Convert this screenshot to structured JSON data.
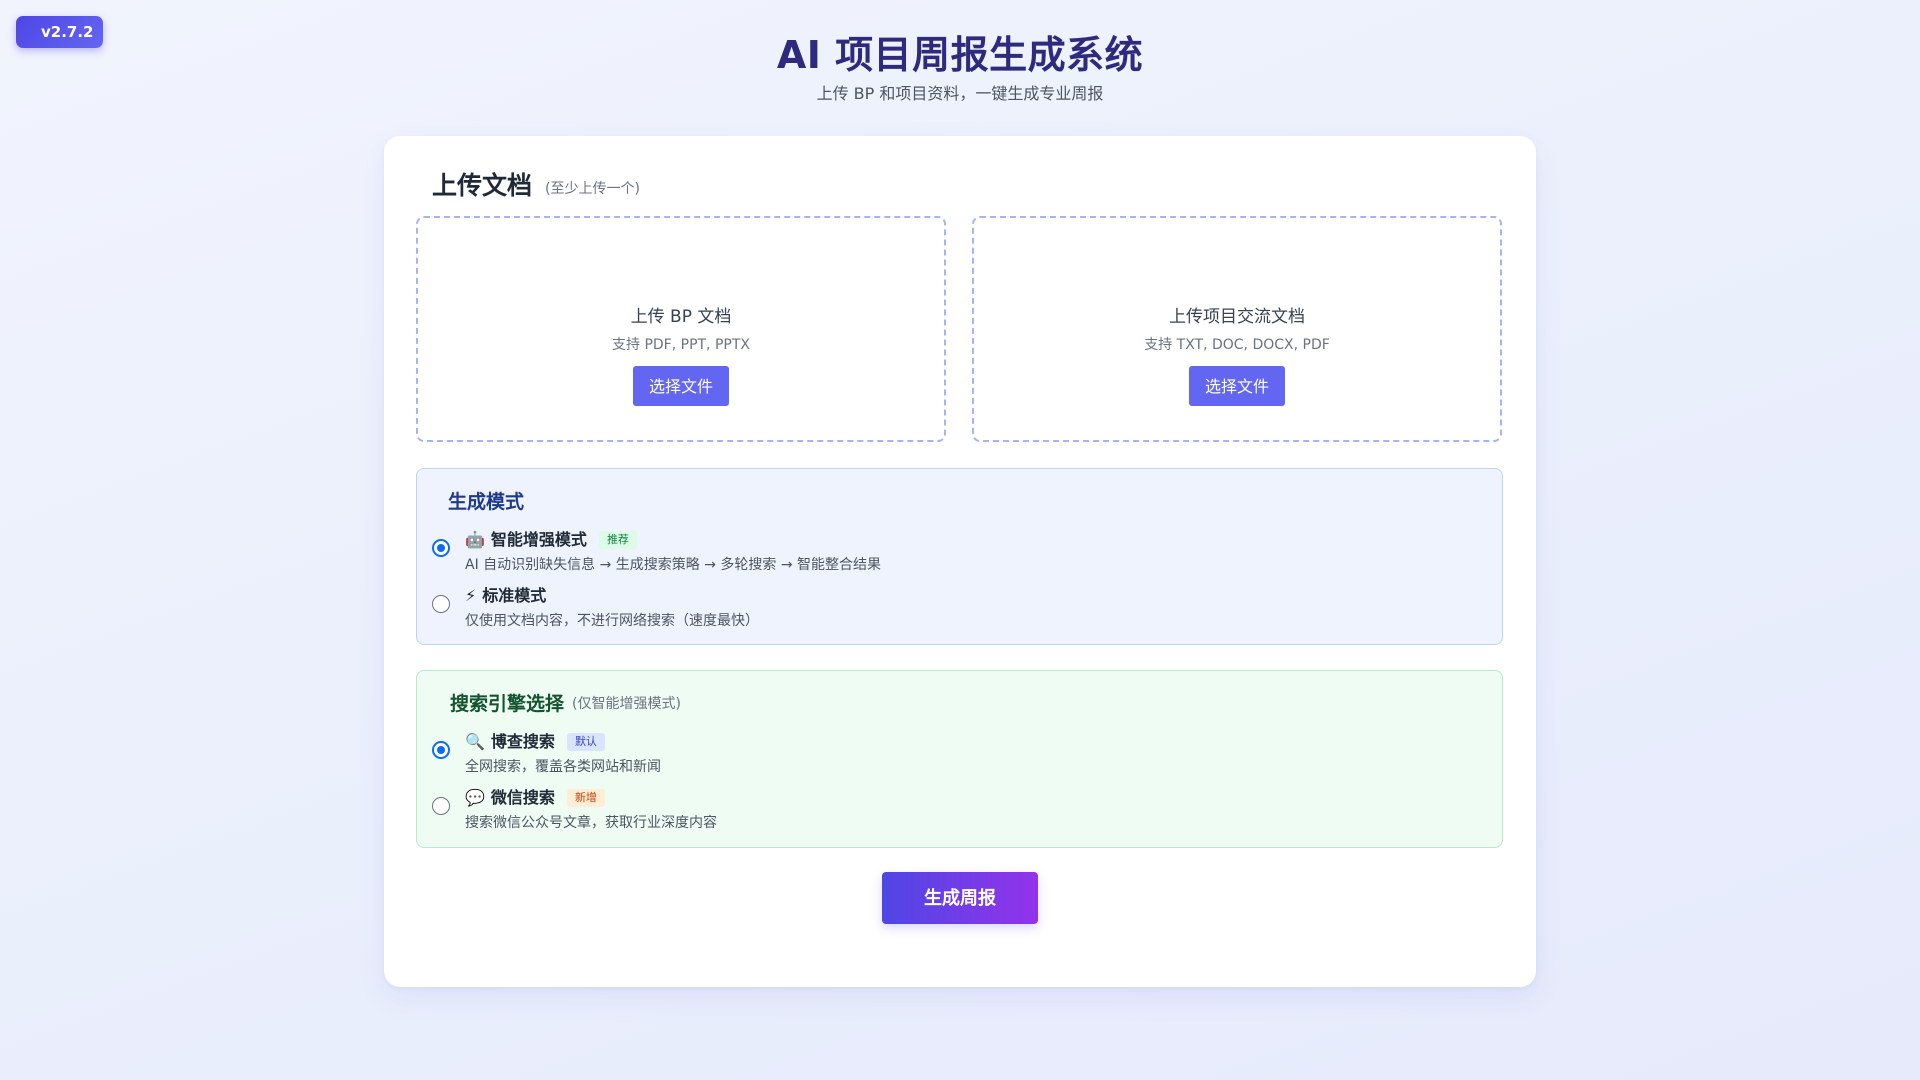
{
  "version": "v2.7.2",
  "header": {
    "title": "AI 项目周报生成系统",
    "subtitle": "上传 BP 和项目资料，一键生成专业周报"
  },
  "upload": {
    "heading": "上传文档",
    "hint": "(至少上传一个)",
    "boxes": [
      {
        "title": "上传 BP 文档",
        "formats": "支持 PDF, PPT, PPTX",
        "button": "选择文件"
      },
      {
        "title": "上传项目交流文档",
        "formats": "支持 TXT, DOC, DOCX, PDF",
        "button": "选择文件"
      }
    ]
  },
  "mode": {
    "heading": "生成模式",
    "options": [
      {
        "icon": "🤖",
        "icon_name": "robot-icon",
        "title": "智能增强模式",
        "tag": "推荐",
        "desc": "AI 自动识别缺失信息 → 生成搜索策略 → 多轮搜索 → 智能整合结果",
        "selected": true
      },
      {
        "icon": "⚡",
        "icon_name": "lightning-icon",
        "title": "标准模式",
        "tag": "",
        "desc": "仅使用文档内容，不进行网络搜索（速度最快）",
        "selected": false
      }
    ]
  },
  "engine": {
    "heading": "搜索引擎选择",
    "hint": "(仅智能增强模式)",
    "options": [
      {
        "icon": "🔍",
        "icon_name": "magnifier-icon",
        "title": "博查搜索",
        "tag": "默认",
        "desc": "全网搜索，覆盖各类网站和新闻",
        "selected": true
      },
      {
        "icon": "💬",
        "icon_name": "speech-bubble-icon",
        "title": "微信搜索",
        "tag": "新增",
        "desc": "搜索微信公众号文章，获取行业深度内容",
        "selected": false
      }
    ]
  },
  "actions": {
    "generate": "生成周报"
  },
  "colors": {
    "accent": "#6366f1",
    "title": "#2e2a7d",
    "radio_selected": "#0b6cf5"
  }
}
